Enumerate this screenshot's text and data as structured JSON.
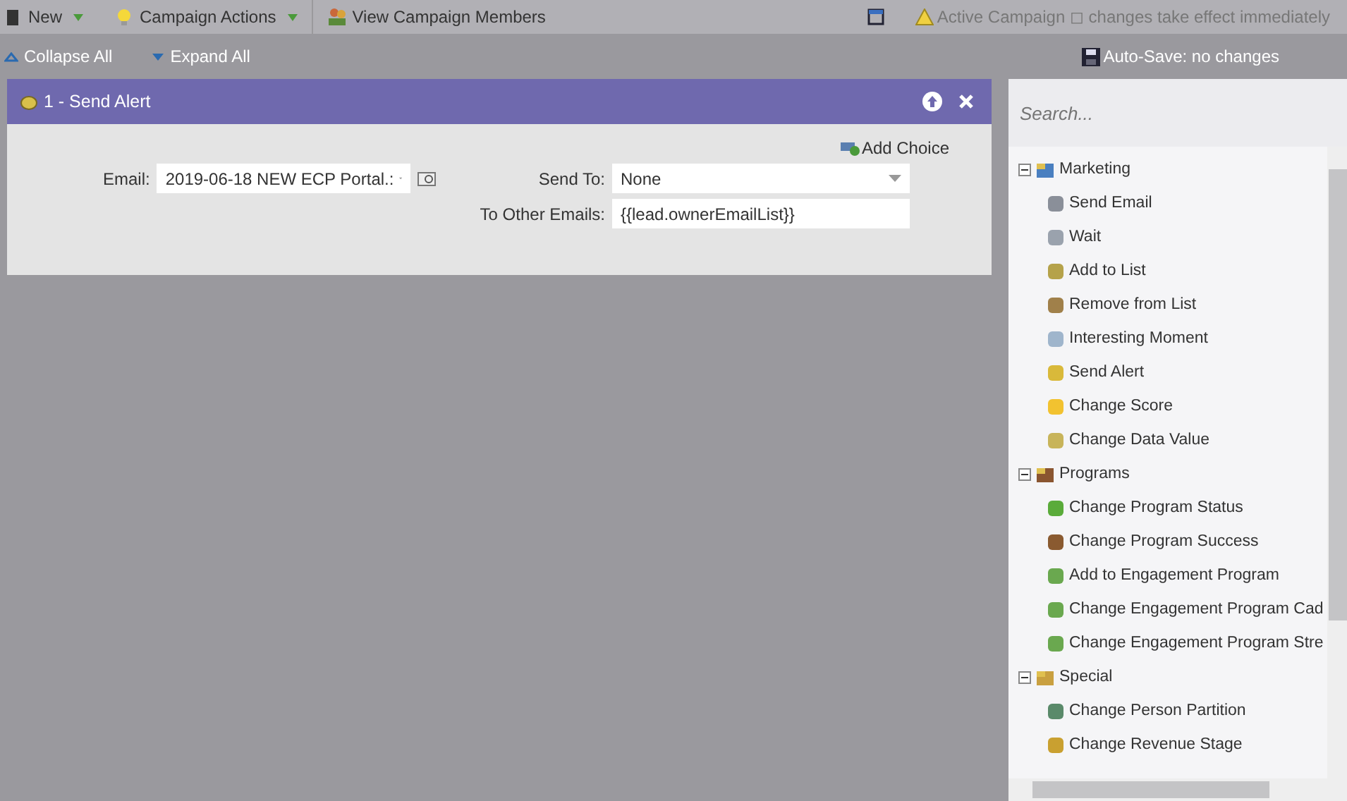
{
  "toolbar": {
    "items": [
      {
        "label": "New",
        "dropdown": true
      },
      {
        "label": "Campaign Actions",
        "dropdown": true
      },
      {
        "label": "View Campaign Members",
        "dropdown": false
      }
    ],
    "notice": "Active Campaign ◻ changes take effect immediately"
  },
  "subbar": {
    "collapse": "Collapse All",
    "expand": "Expand All",
    "autosave": "Auto-Save: no changes"
  },
  "flow_step": {
    "title": "1 - Send Alert",
    "add_choice": "Add Choice",
    "fields": [
      {
        "label": "Email:",
        "value": "2019-06-18 NEW ECP Portal.:",
        "kind": "select"
      },
      {
        "label": "Send To:",
        "value": "None",
        "kind": "select"
      },
      {
        "label": "To Other Emails:",
        "value": "{{lead.ownerEmailList}}",
        "kind": "text"
      }
    ]
  },
  "palette": {
    "search": {
      "placeholder": "Search..."
    },
    "groups": [
      {
        "label": "Marketing",
        "expanded": true,
        "children": [
          {
            "label": "Send Email"
          },
          {
            "label": "Wait"
          },
          {
            "label": "Add to List"
          },
          {
            "label": "Remove from List"
          },
          {
            "label": "Interesting Moment"
          },
          {
            "label": "Send Alert"
          },
          {
            "label": "Change Score"
          },
          {
            "label": "Change Data Value"
          }
        ]
      },
      {
        "label": "Programs",
        "expanded": true,
        "children": [
          {
            "label": "Change Program Status"
          },
          {
            "label": "Change Program Success"
          },
          {
            "label": "Add to Engagement Program"
          },
          {
            "label": "Change Engagement Program Cad"
          },
          {
            "label": "Change Engagement Program Stre"
          }
        ]
      },
      {
        "label": "Special",
        "expanded": true,
        "children": [
          {
            "label": "Change Person Partition"
          },
          {
            "label": "Change Revenue Stage"
          }
        ]
      }
    ]
  }
}
